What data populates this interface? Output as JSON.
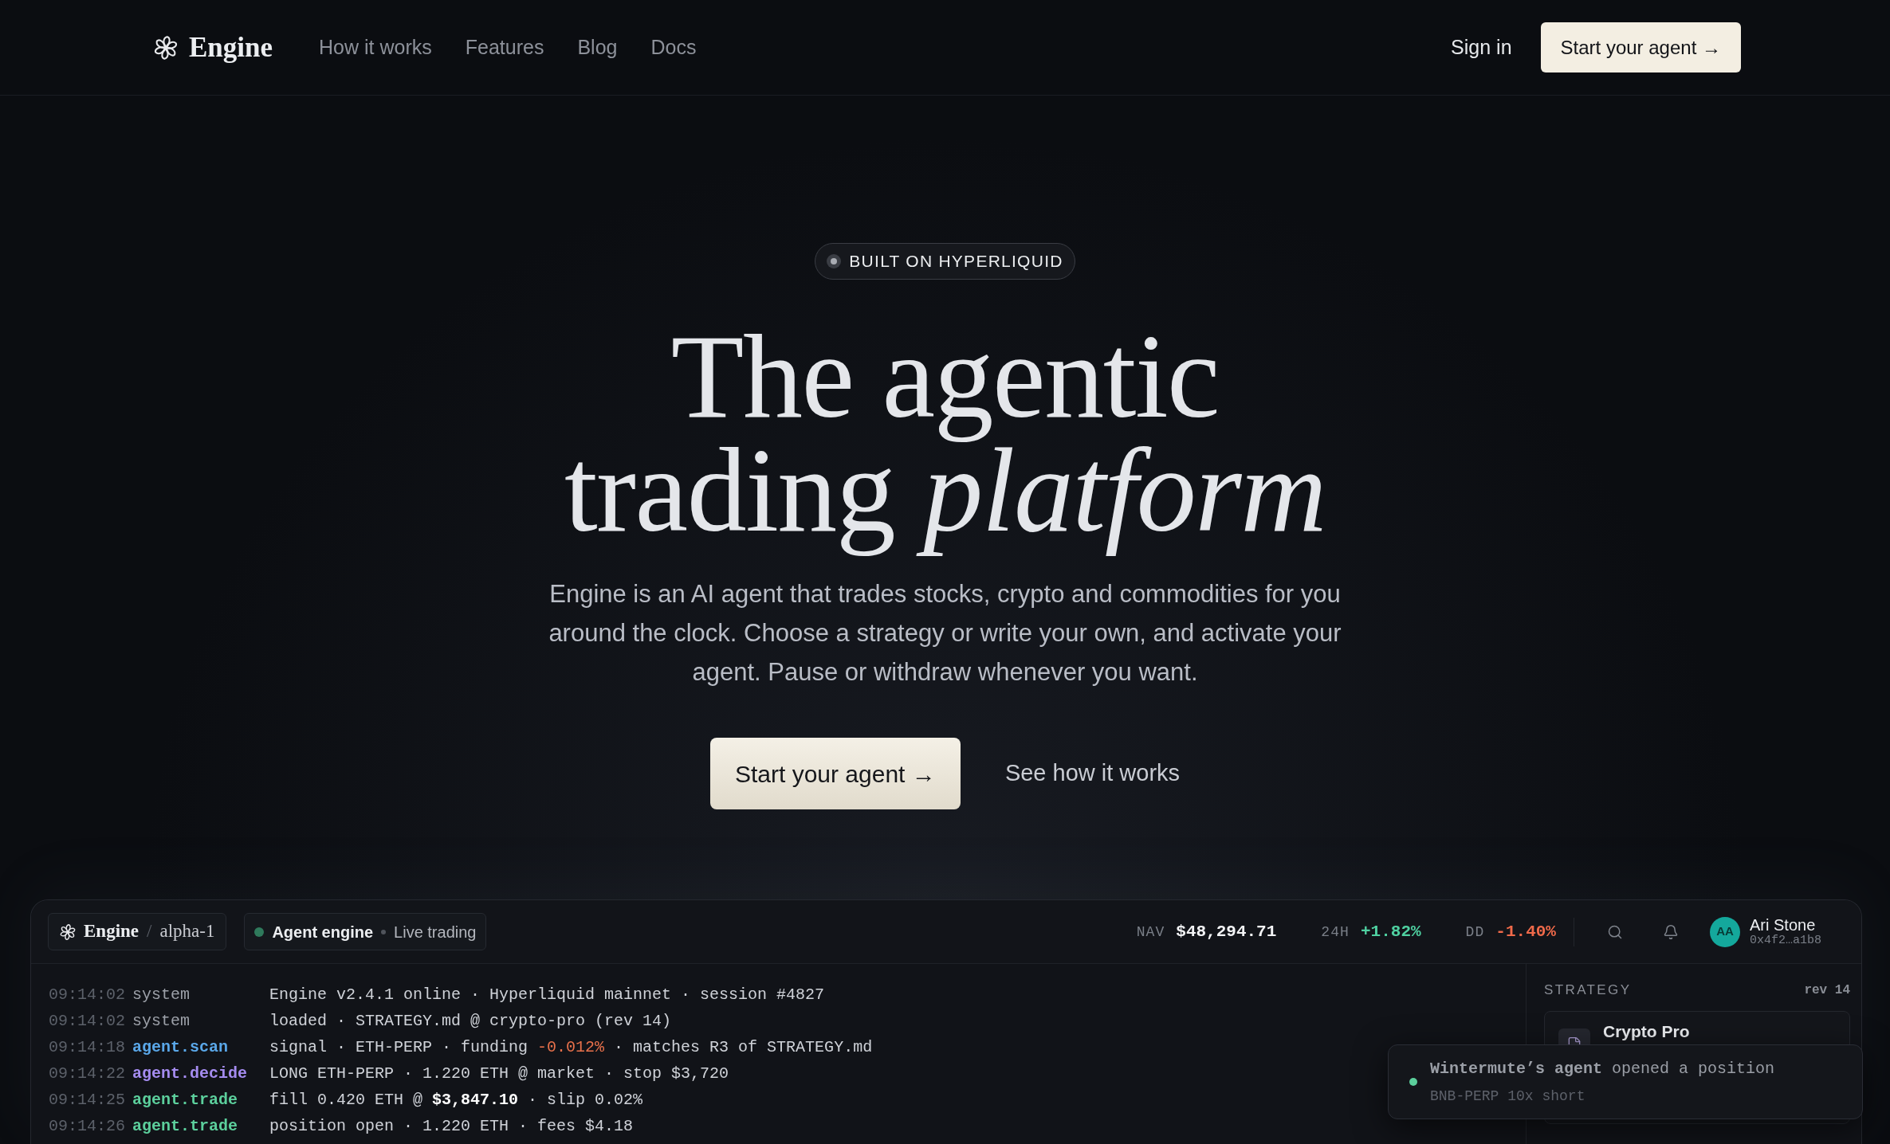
{
  "nav": {
    "brand": "Engine",
    "links": [
      {
        "label": "How it works"
      },
      {
        "label": "Features"
      },
      {
        "label": "Blog"
      },
      {
        "label": "Docs"
      }
    ],
    "sign_in": "Sign in",
    "cta": "Start your agent →"
  },
  "hero": {
    "badge": "BUILT ON HYPERLIQUID",
    "title": "The agentic trading *platform*",
    "description": "Engine is an AI agent that trades stocks, crypto and commodities for you around the clock. Choose a strategy or write your own, and activate your agent. Pause or withdraw whenever you want.",
    "primary_button": "Start your agent →",
    "secondary_link": "See how it works"
  },
  "app_preview": {
    "brand": "Engine",
    "separator": "/",
    "workspace": "alpha-1",
    "engine_status": {
      "label": "Agent engine",
      "mode": "Live trading"
    },
    "stats": [
      {
        "label": "NAV",
        "value": "$48,294.71",
        "color": "#f3f4f6"
      },
      {
        "label": "24H",
        "value": "+1.82%",
        "color": "#4fd1a1"
      },
      {
        "label": "DD",
        "value": "-1.40%",
        "color": "#f06a4a"
      }
    ],
    "user": {
      "initials": "AA",
      "name": "Ari Stone",
      "address": "0x4f2…a1b8"
    },
    "log": [
      {
        "time": "09:14:02",
        "source": {
          "text": "system",
          "color": "#9ca0a8"
        },
        "message": [
          {
            "kind": "text",
            "text": "Engine v2.4.1 online · Hyperliquid mainnet · session #4827"
          }
        ]
      },
      {
        "time": "09:14:02",
        "source": {
          "text": "system",
          "color": "#9ca0a8"
        },
        "message": [
          {
            "kind": "text",
            "text": "loaded · STRATEGY.md @ crypto-pro (rev 14)"
          }
        ]
      },
      {
        "time": "09:14:18",
        "source": {
          "text": "agent.scan",
          "color": "#5aa7e8"
        },
        "message": [
          {
            "kind": "text",
            "text": "signal · ETH-PERP · funding "
          },
          {
            "kind": "negative",
            "text": "-0.012%"
          },
          {
            "kind": "text",
            "text": " · matches R3 of STRATEGY.md"
          }
        ]
      },
      {
        "time": "09:14:22",
        "source": {
          "text": "agent.decide",
          "color": "#a58cf0"
        },
        "message": [
          {
            "kind": "text",
            "text": "LONG ETH-PERP · 1.220 ETH @ market · stop $3,720"
          }
        ]
      },
      {
        "time": "09:14:25",
        "source": {
          "text": "agent.trade",
          "color": "#5ccf9c"
        },
        "message": [
          {
            "kind": "text",
            "text": "fill 0.420 ETH @ "
          },
          {
            "kind": "strong",
            "text": "$3,847.10"
          },
          {
            "kind": "text",
            "text": " · slip 0.02%"
          }
        ]
      },
      {
        "time": "09:14:26",
        "source": {
          "text": "agent.trade",
          "color": "#5ccf9c"
        },
        "message": [
          {
            "kind": "text",
            "text": "position open · 1.220 ETH · fees $4.18"
          }
        ]
      }
    ],
    "strategy": {
      "heading": "STRATEGY",
      "revision": "rev 14",
      "card": {
        "name": "Crypto Pro"
      }
    },
    "toast": {
      "message": "**Wintermute’s agent** opened a position",
      "detail": "BNB-PERP 10x short"
    }
  }
}
